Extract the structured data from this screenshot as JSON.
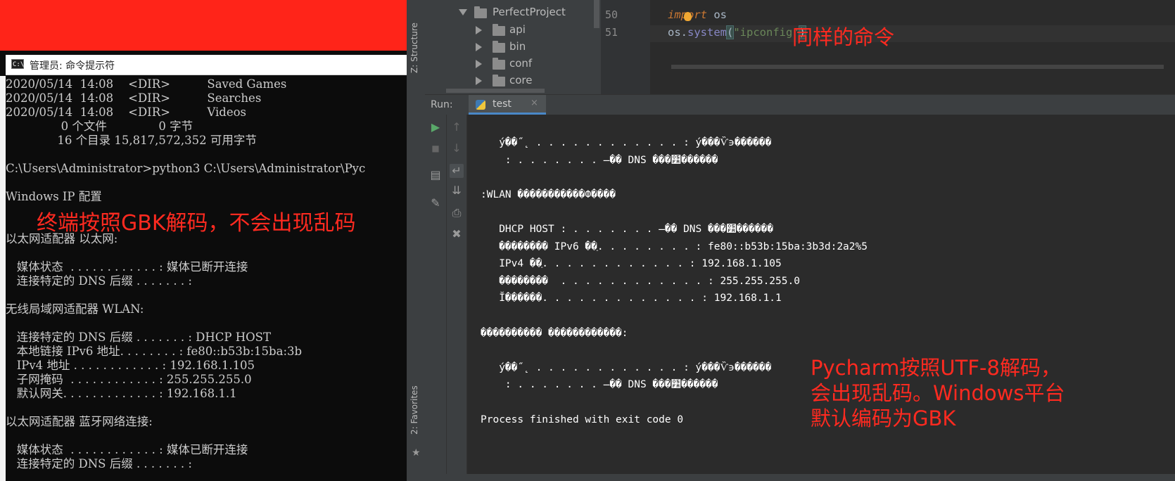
{
  "cmd": {
    "title": "管理员: 命令提示符",
    "title_icon_text": "C:\\.",
    "lines": [
      "2020/05/14  14:08    <DIR>          Saved Games",
      "2020/05/14  14:08    <DIR>          Searches",
      "2020/05/14  14:08    <DIR>          Videos",
      "               0 个文件              0 字节",
      "              16 个目录 15,817,572,352 可用字节",
      "",
      "C:\\Users\\Administrator>python3 C:\\Users\\Administrator\\Pyc",
      "",
      "Windows IP 配置",
      "",
      "",
      "以太网适配器 以太网:",
      "",
      "   媒体状态  . . . . . . . . . . . . : 媒体已断开连接",
      "   连接特定的 DNS 后缀 . . . . . . . :",
      "",
      "无线局域网适配器 WLAN:",
      "",
      "   连接特定的 DNS 后缀 . . . . . . . : DHCP HOST",
      "   本地链接 IPv6 地址. . . . . . . . : fe80::b53b:15ba:3b",
      "   IPv4 地址 . . . . . . . . . . . . : 192.168.1.105",
      "   子网掩码  . . . . . . . . . . . . : 255.255.255.0",
      "   默认网关. . . . . . . . . . . . . : 192.168.1.1",
      "",
      "以太网适配器 蓝牙网络连接:",
      "",
      "   媒体状态  . . . . . . . . . . . . : 媒体已断开连接",
      "   连接特定的 DNS 后缀 . . . . . . . :"
    ],
    "annotation": "终端按照GBK解码，不会出现乱码"
  },
  "pycharm": {
    "side_labels": {
      "structure": "Z: Structure",
      "favorites": "2: Favorites"
    },
    "project_tree": {
      "root": "PerfectProject",
      "children": [
        "api",
        "bin",
        "conf",
        "core"
      ]
    },
    "editor": {
      "line_numbers": [
        "50",
        "51"
      ],
      "line50": {
        "kw": "import",
        "rest": " os"
      },
      "line51": {
        "obj": "os.",
        "fn": "system",
        "open": "(",
        "str": "\"ipconfig\"",
        "close": ")"
      },
      "annotation": "同样的命令"
    },
    "run": {
      "label": "Run:",
      "tab": "test",
      "close": "×",
      "console_lines": [
        "   ý��˝˛ . . . . . . . . . . . . : ý���Ѷ϶������",
        "    : . . . . . . . ̶�� DNS ���׺������",
        "",
        ":WLAN �����������Ф����",
        "",
        "   DHCP HOST : . . . . . . . ̶�� DNS ���׺������",
        "   �������� IPv6 ��ַ. . . . . . . . : fe80::b53b:15ba:3b3d:2a2%5",
        "   IPv4 ��ַ. . . . . . . . . . . . : 192.168.1.105",
        "   ��������  . . . . . . . . . . . . : 255.255.255.0",
        "   Ĭ������. . . . . . . . . . . . . : 192.168.1.1",
        "",
        "���������� ������������:",
        "",
        "   ý��˝˛ . . . . . . . . . . . . : ý���Ѷ϶������",
        "    : . . . . . . . ̶�� DNS ���׺������",
        "",
        "Process finished with exit code 0"
      ],
      "annotation": "Pycharm按照UTF-8解码，\n会出现乱码。Windows平台\n默认编码为GBK"
    }
  }
}
